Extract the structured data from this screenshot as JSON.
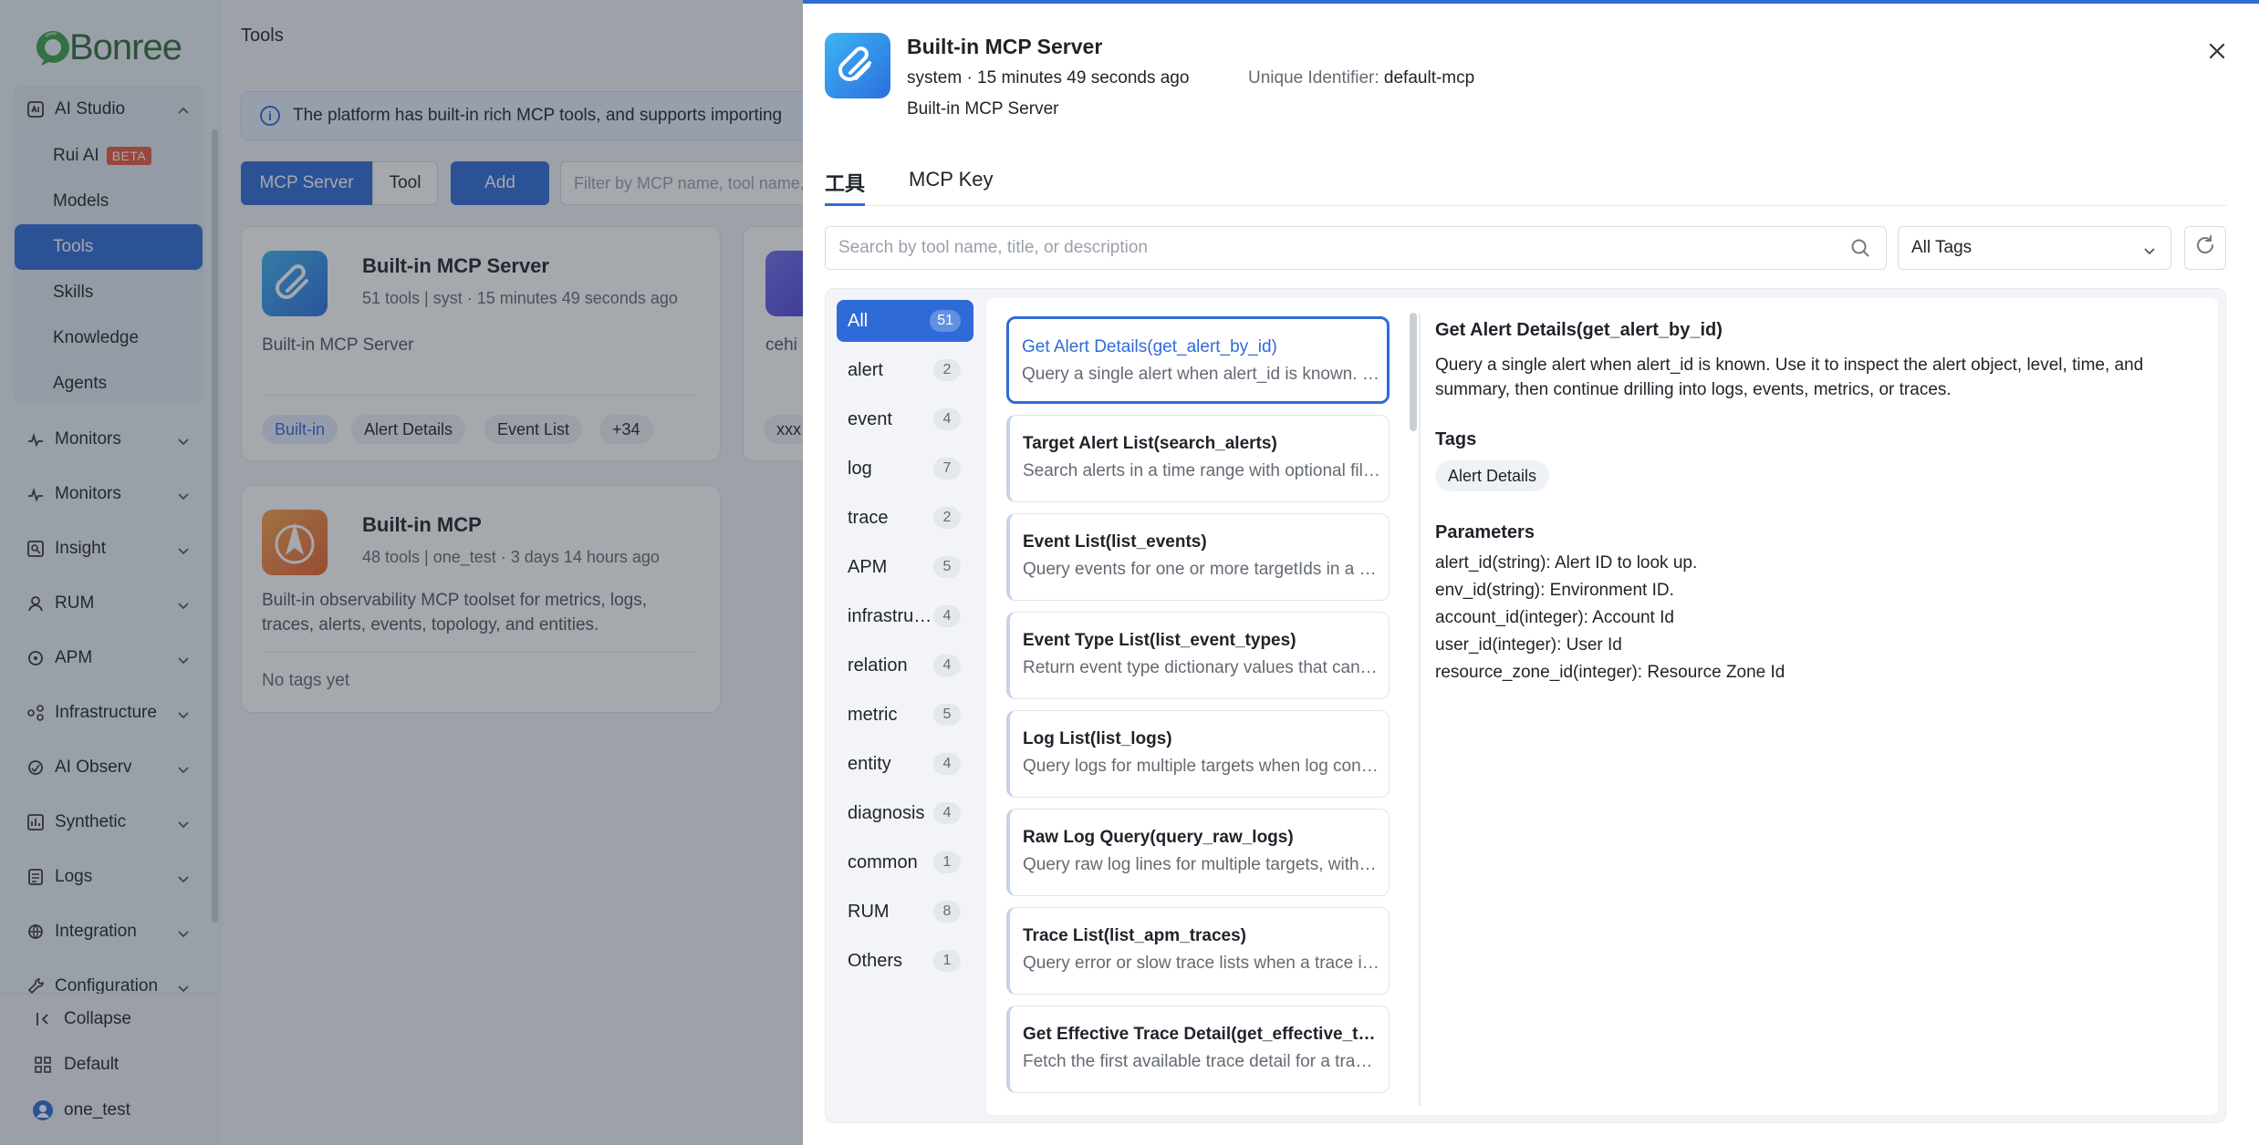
{
  "brand": {
    "name": "Bonree"
  },
  "sidebar": {
    "studio": {
      "label": "AI Studio",
      "items": [
        {
          "label": "Rui AI",
          "badge": "BETA"
        },
        {
          "label": "Models"
        },
        {
          "label": "Tools"
        },
        {
          "label": "Skills"
        },
        {
          "label": "Knowledge"
        },
        {
          "label": "Agents"
        }
      ]
    },
    "groups": [
      {
        "label": "Monitors"
      },
      {
        "label": "Monitors"
      },
      {
        "label": "Insight"
      },
      {
        "label": "RUM"
      },
      {
        "label": "APM"
      },
      {
        "label": "Infrastructure"
      },
      {
        "label": "AI Observ"
      },
      {
        "label": "Synthetic"
      },
      {
        "label": "Logs"
      },
      {
        "label": "Integration"
      },
      {
        "label": "Configuration"
      }
    ],
    "footer": {
      "collapse": "Collapse",
      "workspace": "Default",
      "user": "one_test"
    }
  },
  "main": {
    "title": "Tools",
    "notice": "The platform has built-in rich MCP tools, and supports importing",
    "seg": {
      "server": "MCP Server",
      "tool": "Tool"
    },
    "add": "Add",
    "filter_placeholder": "Filter by MCP name, tool name, title, or description",
    "cards": [
      {
        "name": "Built-in MCP Server",
        "meta": "51 tools  |  syst · 15 minutes 49 seconds ago",
        "desc": "Built-in MCP Server",
        "tags": [
          "Built-in",
          "Alert Details",
          "Event List",
          "+34"
        ]
      },
      {
        "name": "Built-in MCP",
        "meta": "48 tools  |  one_test · 3 days 14 hours ago",
        "desc": "Built-in observability MCP toolset for metrics, logs, traces, alerts, events, topology, and entities.",
        "empty": "No tags yet"
      },
      {
        "desc": "cehi",
        "tags": [
          "xxx"
        ]
      }
    ]
  },
  "drawer": {
    "title": "Built-in MCP Server",
    "meta": "system · 15 minutes 49 seconds ago",
    "uid_label": "Unique Identifier: ",
    "uid_value": "default-mcp",
    "desc": "Built-in MCP Server",
    "tabs": [
      "工具",
      "MCP Key"
    ],
    "search_placeholder": "Search by tool name, title, or description",
    "tag_select": "All Tags",
    "categories": [
      {
        "name": "All",
        "count": "51"
      },
      {
        "name": "alert",
        "count": "2"
      },
      {
        "name": "event",
        "count": "4"
      },
      {
        "name": "log",
        "count": "7"
      },
      {
        "name": "trace",
        "count": "2"
      },
      {
        "name": "APM",
        "count": "5"
      },
      {
        "name": "infrastructure",
        "count": "4"
      },
      {
        "name": "relation",
        "count": "4"
      },
      {
        "name": "metric",
        "count": "5"
      },
      {
        "name": "entity",
        "count": "4"
      },
      {
        "name": "diagnosis",
        "count": "4"
      },
      {
        "name": "common",
        "count": "1"
      },
      {
        "name": "RUM",
        "count": "8"
      },
      {
        "name": "Others",
        "count": "1"
      }
    ],
    "tools": [
      {
        "title": "Get Alert Details(get_alert_by_id)",
        "desc": "Query a single alert when alert_id is known. Use it to inspect the alert object"
      },
      {
        "title": "Target Alert List(search_alerts)",
        "desc": "Search alerts in a time range with optional filters"
      },
      {
        "title": "Event List(list_events)",
        "desc": "Query events for one or more targetIds in a time range"
      },
      {
        "title": "Event Type List(list_event_types)",
        "desc": "Return event type dictionary values that can be used"
      },
      {
        "title": "Log List(list_logs)",
        "desc": "Query logs for multiple targets when log context is needed"
      },
      {
        "title": "Raw Log Query(query_raw_logs)",
        "desc": "Query raw log lines for multiple targets, with filters"
      },
      {
        "title": "Trace List(list_apm_traces)",
        "desc": "Query error or slow trace lists when a trace is needed"
      },
      {
        "title": "Get Effective Trace Detail(get_effective_trace_detail)",
        "desc": "Fetch the first available trace detail for a trace id"
      }
    ],
    "detail": {
      "title": "Get Alert Details(get_alert_by_id)",
      "desc": "Query a single alert when alert_id is known. Use it to inspect the alert object, level, time, and summary, then continue drilling into logs, events, metrics, or traces.",
      "tags_label": "Tags",
      "tags": [
        "Alert Details"
      ],
      "params_label": "Parameters",
      "params": [
        "alert_id(string): Alert ID to look up.",
        "env_id(string): Environment ID.",
        "account_id(integer): Account Id",
        "user_id(integer): User Id",
        "resource_zone_id(integer): Resource Zone Id"
      ]
    }
  }
}
